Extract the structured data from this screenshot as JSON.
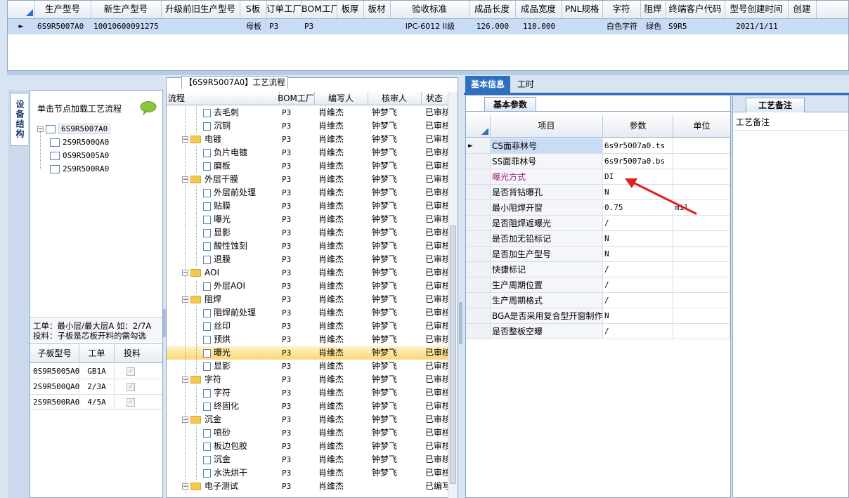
{
  "top_grid": {
    "headers": [
      "生产型号",
      "新生产型号",
      "升级前旧生产型号",
      "S板",
      "订单工厂",
      "BOM工厂",
      "板厚",
      "板材",
      "验收标准",
      "成品长度",
      "成品宽度",
      "PNL规格",
      "字符",
      "阻焊",
      "终端客户代码",
      "型号创建时间",
      "创建"
    ],
    "row": [
      "6S9R5007A0",
      "10010600091275",
      "",
      "母板",
      "P3",
      "P3",
      "",
      "",
      "IPC-6012 II级",
      "126.000",
      "110.000",
      "",
      "白色字符",
      "绿色",
      "S9R5",
      "2021/1/11",
      ""
    ]
  },
  "left": {
    "vertical_tab": "设备结构",
    "hint": "单击节点加载工艺流程",
    "tree_root": "6S9R5007A0",
    "tree_children": [
      "2S9R500QA0",
      "0S9R5005A0",
      "2S9R500RA0"
    ],
    "note_line1": "工单：最小层/最大层A 如：2/7A",
    "note_line2": "投料：子板是芯板开料的需勾选",
    "sub_headers": [
      "子板型号",
      "工单",
      "投料"
    ],
    "sub_rows": [
      {
        "model": "0S9R5005A0",
        "order": "GB1A"
      },
      {
        "model": "2S9R500QA0",
        "order": "2/3A"
      },
      {
        "model": "2S9R500RA0",
        "order": "4/5A"
      }
    ]
  },
  "middle": {
    "title": "【6S9R5007A0】工艺流程",
    "headers": [
      "流程",
      "BOM工厂",
      "编写人",
      "核审人",
      "状态"
    ],
    "rows": [
      {
        "type": "leaf",
        "name": "去毛刺",
        "bom": "P3",
        "writer": "肖维杰",
        "reviewer": "钟梦飞",
        "status": "已审核"
      },
      {
        "type": "leaf",
        "name": "沉铜",
        "bom": "P3",
        "writer": "肖维杰",
        "reviewer": "钟梦飞",
        "status": "已审核"
      },
      {
        "type": "folder",
        "name": "电镀",
        "bom": "P3",
        "writer": "肖维杰",
        "reviewer": "钟梦飞",
        "status": "已审核"
      },
      {
        "type": "leaf",
        "name": "负片电镀",
        "bom": "P3",
        "writer": "肖维杰",
        "reviewer": "钟梦飞",
        "status": "已审核"
      },
      {
        "type": "leaf",
        "name": "磨板",
        "bom": "P3",
        "writer": "肖维杰",
        "reviewer": "钟梦飞",
        "status": "已审核"
      },
      {
        "type": "folder",
        "name": "外层干膜",
        "bom": "P3",
        "writer": "肖维杰",
        "reviewer": "钟梦飞",
        "status": "已审核"
      },
      {
        "type": "leaf",
        "name": "外层前处理",
        "bom": "P3",
        "writer": "肖维杰",
        "reviewer": "钟梦飞",
        "status": "已审核"
      },
      {
        "type": "leaf",
        "name": "贴膜",
        "bom": "P3",
        "writer": "肖维杰",
        "reviewer": "钟梦飞",
        "status": "已审核"
      },
      {
        "type": "leaf",
        "name": "曝光",
        "bom": "P3",
        "writer": "肖维杰",
        "reviewer": "钟梦飞",
        "status": "已审核"
      },
      {
        "type": "leaf",
        "name": "显影",
        "bom": "P3",
        "writer": "肖维杰",
        "reviewer": "钟梦飞",
        "status": "已审核"
      },
      {
        "type": "leaf",
        "name": "酸性蚀刻",
        "bom": "P3",
        "writer": "肖维杰",
        "reviewer": "钟梦飞",
        "status": "已审核"
      },
      {
        "type": "leaf",
        "name": "退膜",
        "bom": "P3",
        "writer": "肖维杰",
        "reviewer": "钟梦飞",
        "status": "已审核"
      },
      {
        "type": "folder",
        "name": "AOI",
        "bom": "P3",
        "writer": "肖维杰",
        "reviewer": "钟梦飞",
        "status": "已审核"
      },
      {
        "type": "leaf",
        "name": "外层AOI",
        "bom": "P3",
        "writer": "肖维杰",
        "reviewer": "钟梦飞",
        "status": "已审核"
      },
      {
        "type": "folder",
        "name": "阻焊",
        "bom": "P3",
        "writer": "肖维杰",
        "reviewer": "钟梦飞",
        "status": "已审核"
      },
      {
        "type": "leaf",
        "name": "阻焊前处理",
        "bom": "P3",
        "writer": "肖维杰",
        "reviewer": "钟梦飞",
        "status": "已审核"
      },
      {
        "type": "leaf",
        "name": "丝印",
        "bom": "P3",
        "writer": "肖维杰",
        "reviewer": "钟梦飞",
        "status": "已审核"
      },
      {
        "type": "leaf",
        "name": "预烘",
        "bom": "P3",
        "writer": "肖维杰",
        "reviewer": "钟梦飞",
        "status": "已审核"
      },
      {
        "type": "leaf",
        "name": "曝光",
        "bom": "P3",
        "writer": "肖维杰",
        "reviewer": "钟梦飞",
        "status": "已审核",
        "selected": true
      },
      {
        "type": "leaf",
        "name": "显影",
        "bom": "P3",
        "writer": "肖维杰",
        "reviewer": "钟梦飞",
        "status": "已审核"
      },
      {
        "type": "folder",
        "name": "字符",
        "bom": "P3",
        "writer": "肖维杰",
        "reviewer": "钟梦飞",
        "status": "已审核"
      },
      {
        "type": "leaf",
        "name": "字符",
        "bom": "P3",
        "writer": "肖维杰",
        "reviewer": "钟梦飞",
        "status": "已审核"
      },
      {
        "type": "leaf",
        "name": "终固化",
        "bom": "P3",
        "writer": "肖维杰",
        "reviewer": "钟梦飞",
        "status": "已审核"
      },
      {
        "type": "folder",
        "name": "沉金",
        "bom": "P3",
        "writer": "肖维杰",
        "reviewer": "钟梦飞",
        "status": "已审核"
      },
      {
        "type": "leaf",
        "name": "喷砂",
        "bom": "P3",
        "writer": "肖维杰",
        "reviewer": "钟梦飞",
        "status": "已审核"
      },
      {
        "type": "leaf",
        "name": "板边包胶",
        "bom": "P3",
        "writer": "肖维杰",
        "reviewer": "钟梦飞",
        "status": "已审核"
      },
      {
        "type": "leaf",
        "name": "沉金",
        "bom": "P3",
        "writer": "肖维杰",
        "reviewer": "钟梦飞",
        "status": "已审核"
      },
      {
        "type": "leaf",
        "name": "水洗烘干",
        "bom": "P3",
        "writer": "肖维杰",
        "reviewer": "钟梦飞",
        "status": "已审核"
      },
      {
        "type": "folder",
        "name": "电子测试",
        "bom": "P3",
        "writer": "肖维杰",
        "reviewer": "",
        "status": "已编写"
      }
    ]
  },
  "right": {
    "tabs": [
      "基本信息",
      "工时"
    ],
    "subtab": "基本参数",
    "remark_tab": "工艺备注",
    "remark_label": "工艺备注",
    "headers": [
      "项目",
      "参数",
      "单位"
    ],
    "rows": [
      {
        "item": "CS面菲林号",
        "param": "6s9r5007a0.ts",
        "unit": ""
      },
      {
        "item": "SS面菲林号",
        "param": "6s9r5007a0.bs",
        "unit": ""
      },
      {
        "item": "曝光方式",
        "param": "DI",
        "unit": "",
        "highlight": true
      },
      {
        "item": "是否背钻曝孔",
        "param": "N",
        "unit": ""
      },
      {
        "item": "最小阻焊开窗",
        "param": "0.75",
        "unit": "mil"
      },
      {
        "item": "是否阻焊返曝光",
        "param": "/",
        "unit": ""
      },
      {
        "item": "是否加无铅标记",
        "param": "N",
        "unit": ""
      },
      {
        "item": "是否加生产型号",
        "param": "N",
        "unit": ""
      },
      {
        "item": "快捷标记",
        "param": "/",
        "unit": ""
      },
      {
        "item": "生产周期位置",
        "param": "/",
        "unit": ""
      },
      {
        "item": "生产周期格式",
        "param": "/",
        "unit": ""
      },
      {
        "item": "BGA是否采用复合型开窗制作",
        "param": "N",
        "unit": ""
      },
      {
        "item": "是否整板空曝",
        "param": "/",
        "unit": ""
      }
    ]
  },
  "colors": {
    "accent": "#2f6fc0",
    "selected_row": "#fde7a4",
    "grid_selected": "#c9dcf6",
    "highlight_text": "#a0208a",
    "arrow": "#e02020"
  }
}
